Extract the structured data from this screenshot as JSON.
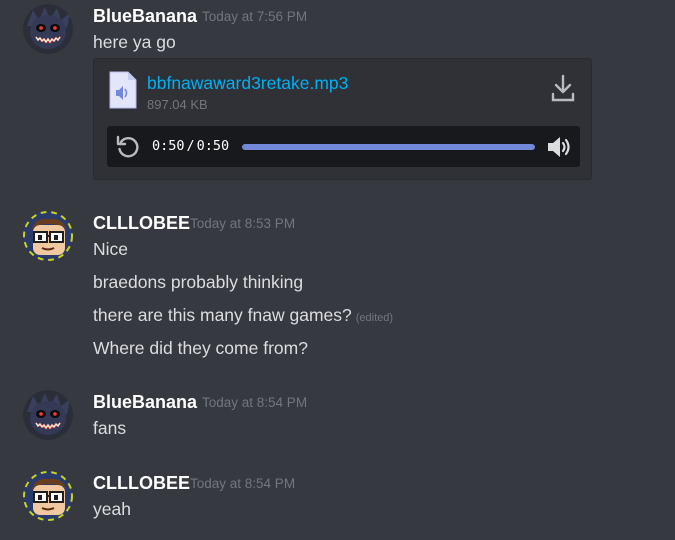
{
  "colors": {
    "progress": "#7289da",
    "link": "#00b0f4",
    "background": "#36393f"
  },
  "messages": [
    {
      "author": "BlueBanana",
      "timestamp": "Today at 7:56 PM",
      "lines": [
        "here ya go"
      ],
      "attachment": {
        "filename": "bbfnawaward3retake.mp3",
        "size": "897.04 KB",
        "current_time": "0:50",
        "duration": "0:50",
        "progress": 1.0,
        "icons": [
          "audio-file-icon",
          "download-icon",
          "replay-icon",
          "volume-icon"
        ]
      }
    },
    {
      "author": "CLLLOBEE",
      "timestamp": "Today at 8:53 PM",
      "lines": [
        "Nice",
        "braedons probably thinking",
        "there are this many fnaw games?",
        "Where did they come from?"
      ],
      "edited_label": "(edited)"
    },
    {
      "author": "BlueBanana",
      "timestamp": "Today at 8:54 PM",
      "lines": [
        "fans"
      ]
    },
    {
      "author": "CLLLOBEE",
      "timestamp": "Today at 8:54 PM",
      "lines": [
        "yeah"
      ]
    }
  ]
}
